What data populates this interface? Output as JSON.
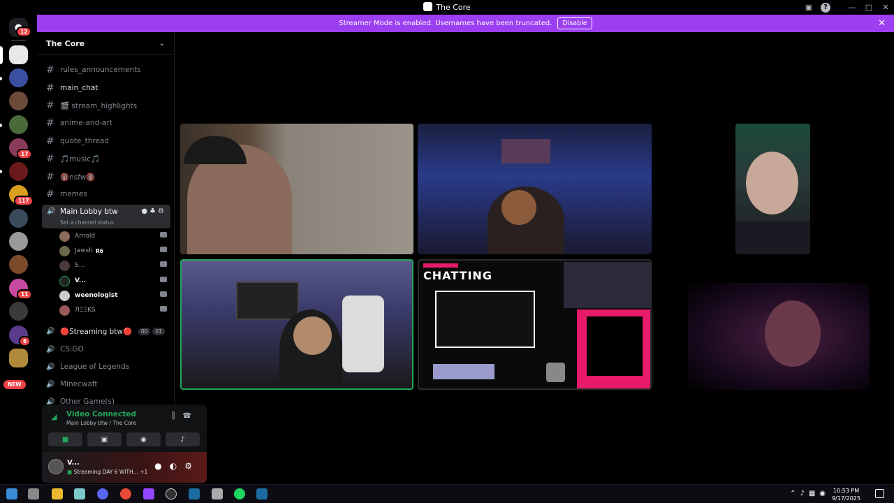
{
  "window": {
    "title": "The Core",
    "controls": {
      "minimize": "—",
      "maximize": "□",
      "close": "✕"
    }
  },
  "banner": {
    "text": "Streamer Mode is enabled. Usernames have been truncated.",
    "disable_label": "Disable"
  },
  "rail": {
    "dm_badge": "12",
    "badges": {
      "s6": "17",
      "s8": "117",
      "s13": "11",
      "s14": "6"
    },
    "new_label": "NEW"
  },
  "guild": {
    "name": "The Core"
  },
  "channels": [
    {
      "name": "rules_announcements"
    },
    {
      "name": "main_chat"
    },
    {
      "name": "🎬 stream_highlights"
    },
    {
      "name": "anime-and-art"
    },
    {
      "name": "quote_thread"
    },
    {
      "name": "🎵music🎵"
    },
    {
      "name": "🔞nsfw🔞"
    },
    {
      "name": "memes"
    }
  ],
  "active_voice": {
    "name": "Main Lobby btw",
    "status": "Set a channel status"
  },
  "members": [
    {
      "name": "Arnold",
      "tag": ""
    },
    {
      "name": "Jawsh",
      "tag": "R6"
    },
    {
      "name": "S...",
      "tag": ""
    },
    {
      "name": "V...",
      "tag": ""
    },
    {
      "name": "weenologist",
      "tag": ""
    },
    {
      "name": "ЛΞΞKS",
      "tag": ""
    }
  ],
  "voice_channels": [
    {
      "name": "🔴Streaming btw🔴",
      "counts": [
        "00",
        "01"
      ]
    },
    {
      "name": "CS:GO"
    },
    {
      "name": "League of Legends"
    },
    {
      "name": "Minecwaft"
    },
    {
      "name": "Other Game(s)"
    }
  ],
  "voice_panel": {
    "title": "Video Connected",
    "subtitle": "Main Lobby btw / The Core"
  },
  "user": {
    "name": "V...",
    "status": "Streaming DAY 6 WITH...",
    "extra": "+1"
  },
  "stream_overlay": {
    "heading": "CHATTING"
  },
  "taskbar": {
    "time": "10:53 PM",
    "date": "9/17/2025"
  },
  "colors": {
    "banner": "#9b3ff0",
    "connected": "#23a559",
    "badge": "#ed4245"
  }
}
